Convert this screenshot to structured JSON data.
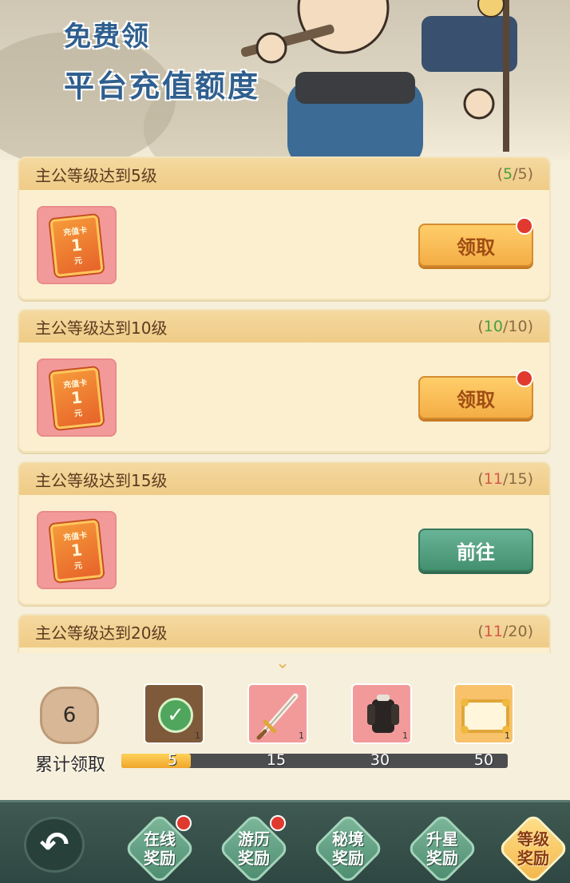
{
  "banner": {
    "line1": "免费领",
    "line2": "平台充值额度"
  },
  "reward_card": {
    "label": "充值卡",
    "amount": "1",
    "unit": "元"
  },
  "tasks": [
    {
      "title": "主公等级达到5级",
      "current": "5",
      "target": "5",
      "complete": true,
      "button": "领取",
      "has_dot": true
    },
    {
      "title": "主公等级达到10级",
      "current": "10",
      "target": "10",
      "complete": true,
      "button": "领取",
      "has_dot": true
    },
    {
      "title": "主公等级达到15级",
      "current": "11",
      "target": "15",
      "complete": false,
      "button": "前往",
      "has_dot": false
    },
    {
      "title": "主公等级达到20级",
      "current": "11",
      "target": "20",
      "complete": false,
      "button": "",
      "has_dot": false
    }
  ],
  "cumulative": {
    "count": "6",
    "label": "累计领取",
    "milestones": [
      {
        "value": "5",
        "qty": "1",
        "icon": "claimed-chest-icon",
        "claimed": true
      },
      {
        "value": "15",
        "qty": "1",
        "icon": "sword-icon",
        "claimed": false
      },
      {
        "value": "30",
        "qty": "1",
        "icon": "armor-icon",
        "claimed": false
      },
      {
        "value": "50",
        "qty": "1",
        "icon": "gold-frame-icon",
        "claimed": false
      }
    ],
    "progress_fraction": 0.18,
    "max": 50
  },
  "nav": {
    "back_icon": "back-arrow-icon",
    "tabs": [
      {
        "line1": "在线",
        "line2": "奖励",
        "has_dot": true,
        "active": false
      },
      {
        "line1": "游历",
        "line2": "奖励",
        "has_dot": true,
        "active": false
      },
      {
        "line1": "秘境",
        "line2": "奖励",
        "has_dot": false,
        "active": false
      },
      {
        "line1": "升星",
        "line2": "奖励",
        "has_dot": false,
        "active": false
      },
      {
        "line1": "等级",
        "line2": "奖励",
        "has_dot": false,
        "active": true
      }
    ]
  },
  "colors": {
    "accent_green": "#45a142",
    "accent_red": "#d7574d",
    "claim_button": "#f4ad45",
    "go_button": "#43906f"
  }
}
